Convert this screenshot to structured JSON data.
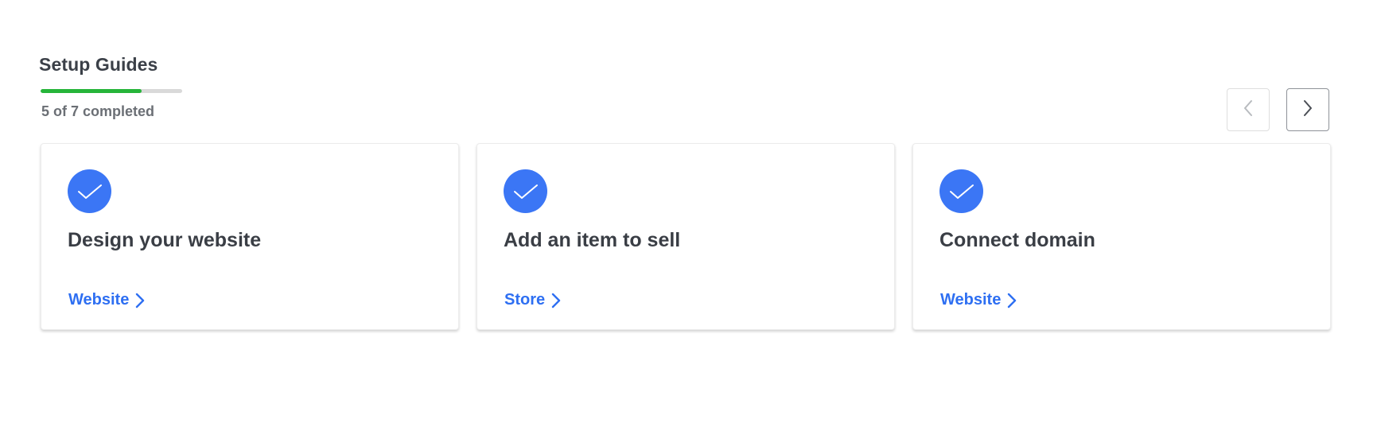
{
  "setup": {
    "title": "Setup Guides",
    "progress_text": "5 of 7 completed",
    "progress_fraction": 0.714,
    "progress_color": "#26b53a"
  },
  "nav": {
    "prev_icon": "chevron-left-icon",
    "next_icon": "chevron-right-icon"
  },
  "cards": [
    {
      "title": "Design your website",
      "link_label": "Website",
      "status_icon": "check-icon"
    },
    {
      "title": "Add an item to sell",
      "link_label": "Store",
      "status_icon": "check-icon"
    },
    {
      "title": "Connect domain",
      "link_label": "Website",
      "status_icon": "check-icon"
    }
  ],
  "colors": {
    "accent": "#3b76f5",
    "link": "#2e6ff2"
  }
}
